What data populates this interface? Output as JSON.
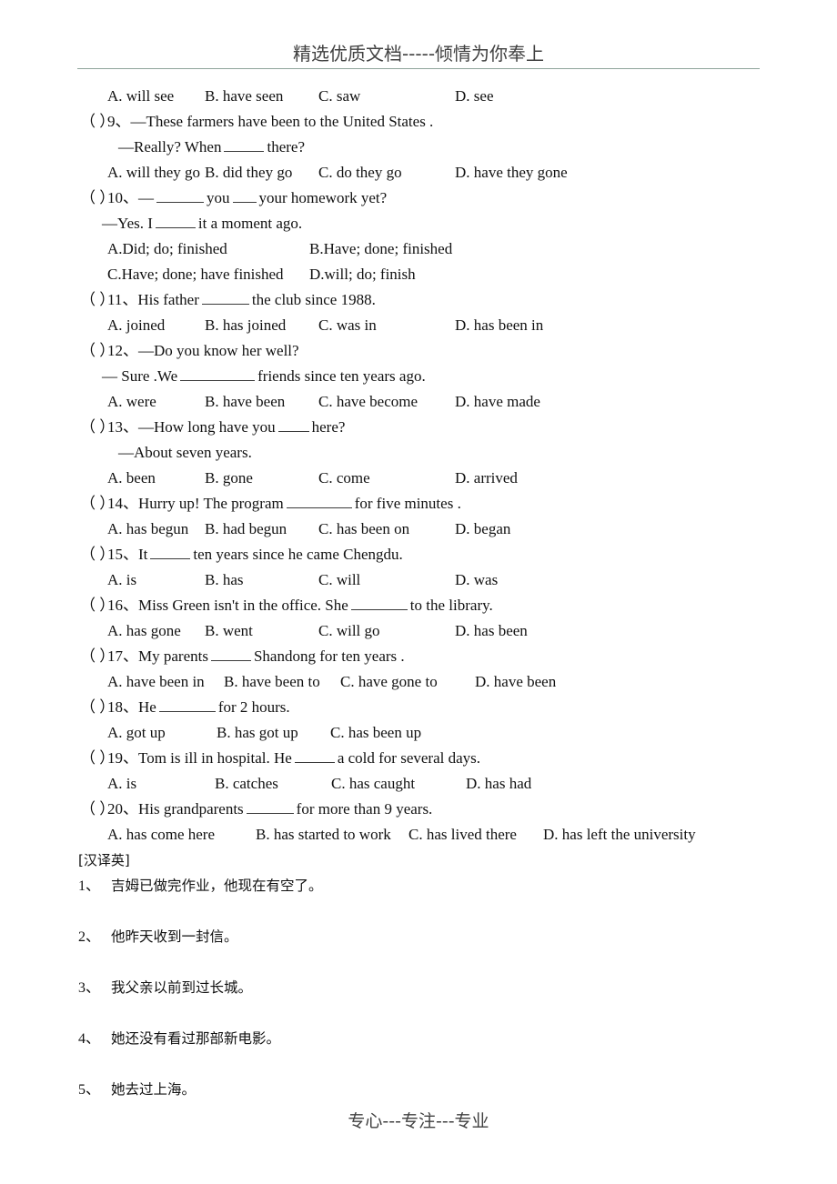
{
  "header": {
    "title": "精选优质文档-----倾情为你奉上"
  },
  "footer": {
    "text": "专心---专注---专业"
  },
  "multiple_choice": {
    "q8_options": {
      "a": "A. will see",
      "b": "B. have seen",
      "c": "C. saw",
      "d": "D. see"
    },
    "questions": [
      {
        "paren": "（  ）",
        "number": "9、",
        "stem": "—These farmers have been to the United States .",
        "stem2_pre": "—Really? When",
        "stem2_post": "there?",
        "options": {
          "a": "A. will they go",
          "b": "B. did they go",
          "c": "C. do they go",
          "d": "D. have they gone"
        }
      },
      {
        "paren": "（  ）",
        "number": "10、",
        "stem_pre": "—",
        "stem_mid": "you",
        "stem_post": "your homework yet?",
        "stem2_pre": "—Yes. I",
        "stem2_post": "it a moment ago.",
        "options": {
          "a": "A.Did; do; finished",
          "b": "B.Have; done; finished",
          "c": "C.Have; done; have   finished",
          "d": "D.will; do; finish"
        }
      },
      {
        "paren": "（  ）",
        "number": "11、",
        "stem_pre": "His father",
        "stem_post": "the club since 1988.",
        "options": {
          "a": "A. joined",
          "b": "B. has joined",
          "c": "C. was in",
          "d": "D. has been in"
        }
      },
      {
        "paren": "（  ）",
        "number": "12、",
        "stem": "—Do you know her well?",
        "stem2_pre": "— Sure .We",
        "stem2_post": "friends since ten years ago.",
        "options": {
          "a": "A. were",
          "b": "B. have been",
          "c": "C. have become",
          "d": "D. have made"
        }
      },
      {
        "paren": "（  ）",
        "number": "13、",
        "stem_pre": "—How long have you",
        "stem_post": "here?",
        "stem2": "—About seven years.",
        "options": {
          "a": "A. been",
          "b": "B. gone",
          "c": "C. come",
          "d": "D. arrived"
        }
      },
      {
        "paren": "（  ）",
        "number": "14、",
        "stem_pre": "Hurry up! The program",
        "stem_post": "for five minutes .",
        "options": {
          "a": "A. has begun",
          "b": "B. had begun",
          "c": "C. has been on",
          "d": "D. began"
        }
      },
      {
        "paren": "（  ）",
        "number": "15、",
        "stem_pre": "It",
        "stem_post": "ten years since he came Chengdu.",
        "options": {
          "a": "A. is",
          "b": "B. has",
          "c": "C. will",
          "d": "D. was"
        }
      },
      {
        "paren": "（  ）",
        "number": "16、",
        "stem_pre": "Miss Green isn't in the office. She",
        "stem_post": "to the library.",
        "options": {
          "a": "A. has gone",
          "b": "B. went",
          "c": "C. will go",
          "d": "D. has been"
        }
      },
      {
        "paren": "（  ）",
        "number": "17、",
        "stem_pre": "My parents",
        "stem_post": "Shandong for ten years .",
        "options": {
          "a": "A. have been in",
          "b": "B. have been to",
          "c": "C.   have gone to",
          "d": "D. have been"
        }
      },
      {
        "paren": "（  ）",
        "number": "18、",
        "stem_pre": "He",
        "stem_post": "for 2 hours.",
        "options": {
          "a": "A. got up",
          "b": "B.   has got up",
          "c": "C. has been up",
          "d": ""
        }
      },
      {
        "paren": "（  ）",
        "number": "19、",
        "stem_pre": "Tom is ill in hospital. He",
        "stem_post": "a cold for several days.",
        "options": {
          "a": "A. is",
          "b": "B. catches",
          "c": "C. has caught",
          "d": "D. has had"
        }
      },
      {
        "paren": "（  ）",
        "number": "20、",
        "stem_pre": "His grandparents",
        "stem_post": "for more than 9 years.",
        "options": {
          "a": "A. has come here",
          "b": "B. has started to work",
          "c": "C. has lived there",
          "d": "D. has left the university"
        }
      }
    ]
  },
  "translation": {
    "section_label": "[汉译英]",
    "items": [
      {
        "number": "1、",
        "text": "吉姆已做完作业，他现在有空了。"
      },
      {
        "number": "2、",
        "text": "他昨天收到一封信。"
      },
      {
        "number": "3、",
        "text": "我父亲以前到过长城。"
      },
      {
        "number": "4、",
        "text": "她还没有看过那部新电影。"
      },
      {
        "number": "5、",
        "text": "她去过上海。"
      }
    ]
  },
  "colors": {
    "rule": "#8fa49b",
    "header_text": "#404040",
    "body_text": "#111111"
  }
}
